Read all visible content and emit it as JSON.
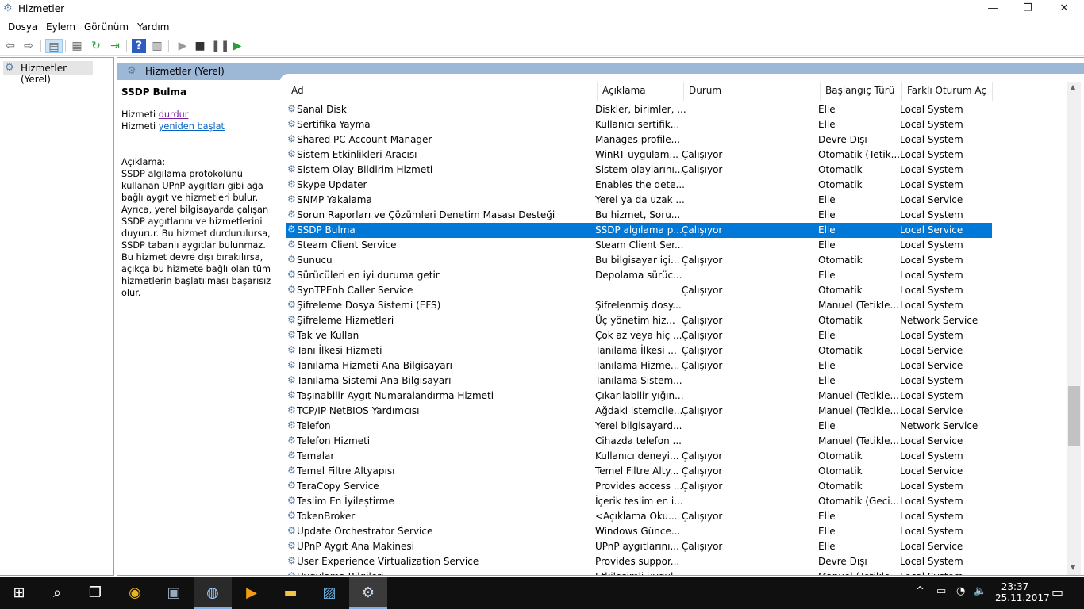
{
  "window": {
    "title": "Hizmetler",
    "minimize": "—",
    "maximize": "❐",
    "close": "✕"
  },
  "menu": [
    "Dosya",
    "Eylem",
    "Görünüm",
    "Yardım"
  ],
  "toolbar": [
    "back-icon",
    "forward-icon",
    "show-hide-tree-icon",
    "properties-icon",
    "refresh-icon",
    "export-icon",
    "help-icon",
    "console-icon",
    "start-icon",
    "stop-icon",
    "pause-icon",
    "resume-icon"
  ],
  "tree": {
    "item": "Hizmetler (Yerel)"
  },
  "center": {
    "header": "Hizmetler (Yerel)"
  },
  "detail": {
    "title": "SSDP Bulma",
    "prefix": "Hizmeti ",
    "stop_link": "durdur",
    "restart_link": "yeniden başlat",
    "desc_label": "Açıklama:",
    "desc": "SSDP algılama protokolünü kullanan UPnP aygıtları gibi ağa bağlı aygıt ve hizmetleri bulur. Ayrıca, yerel bilgisayarda çalışan SSDP aygıtlarını ve hizmetlerini duyurur. Bu hizmet durdurulursa, SSDP tabanlı aygıtlar bulunmaz. Bu hizmet devre dışı bırakılırsa, açıkça bu hizmete bağlı olan tüm hizmetlerin başlatılması başarısız olur."
  },
  "columns": [
    "Ad",
    "Açıklama",
    "Durum",
    "Başlangıç Türü",
    "Farklı Oturum Aç"
  ],
  "selected_row": 8,
  "rows": [
    [
      "Sanal Disk",
      "Diskler, birimler, ...",
      "",
      "Elle",
      "Local System"
    ],
    [
      "Sertifika Yayma",
      "Kullanıcı sertifik...",
      "",
      "Elle",
      "Local System"
    ],
    [
      "Shared PC Account Manager",
      "Manages profile...",
      "",
      "Devre Dışı",
      "Local System"
    ],
    [
      "Sistem Etkinlikleri Aracısı",
      "WinRT uygulam...",
      "Çalışıyor",
      "Otomatik (Tetik...",
      "Local System"
    ],
    [
      "Sistem Olay Bildirim Hizmeti",
      "Sistem olaylarını...",
      "Çalışıyor",
      "Otomatik",
      "Local System"
    ],
    [
      "Skype Updater",
      "Enables the dete...",
      "",
      "Otomatik",
      "Local System"
    ],
    [
      "SNMP Yakalama",
      "Yerel ya da uzak ...",
      "",
      "Elle",
      "Local Service"
    ],
    [
      "Sorun Raporları ve Çözümleri Denetim Masası Desteği",
      "Bu hizmet, Soru...",
      "",
      "Elle",
      "Local System"
    ],
    [
      "SSDP Bulma",
      "SSDP algılama p...",
      "Çalışıyor",
      "Elle",
      "Local Service"
    ],
    [
      "Steam Client Service",
      "Steam Client Ser...",
      "",
      "Elle",
      "Local System"
    ],
    [
      "Sunucu",
      "Bu bilgisayar içi...",
      "Çalışıyor",
      "Otomatik",
      "Local System"
    ],
    [
      "Sürücüleri en iyi duruma getir",
      "Depolama sürüc...",
      "",
      "Elle",
      "Local System"
    ],
    [
      "SynTPEnh Caller Service",
      "",
      "Çalışıyor",
      "Otomatik",
      "Local System"
    ],
    [
      "Şifreleme Dosya Sistemi (EFS)",
      "Şifrelenmiş dosy...",
      "",
      "Manuel (Tetikle...",
      "Local System"
    ],
    [
      "Şifreleme Hizmetleri",
      "Üç yönetim hiz...",
      "Çalışıyor",
      "Otomatik",
      "Network Service"
    ],
    [
      "Tak ve Kullan",
      "Çok az veya hiç ...",
      "Çalışıyor",
      "Elle",
      "Local System"
    ],
    [
      "Tanı İlkesi Hizmeti",
      "Tanılama İlkesi ...",
      "Çalışıyor",
      "Otomatik",
      "Local Service"
    ],
    [
      "Tanılama Hizmeti Ana Bilgisayarı",
      "Tanılama Hizme...",
      "Çalışıyor",
      "Elle",
      "Local Service"
    ],
    [
      "Tanılama Sistemi Ana Bilgisayarı",
      "Tanılama Sistem...",
      "",
      "Elle",
      "Local System"
    ],
    [
      "Taşınabilir Aygıt Numaralandırma Hizmeti",
      "Çıkarılabilir yığın...",
      "",
      "Manuel (Tetikle...",
      "Local System"
    ],
    [
      "TCP/IP NetBIOS Yardımcısı",
      "Ağdaki istemcile...",
      "Çalışıyor",
      "Manuel (Tetikle...",
      "Local Service"
    ],
    [
      "Telefon",
      "Yerel bilgisayard...",
      "",
      "Elle",
      "Network Service"
    ],
    [
      "Telefon Hizmeti",
      "Cihazda telefon ...",
      "",
      "Manuel (Tetikle...",
      "Local Service"
    ],
    [
      "Temalar",
      "Kullanıcı deneyi...",
      "Çalışıyor",
      "Otomatik",
      "Local System"
    ],
    [
      "Temel Filtre Altyapısı",
      "Temel Filtre Alty...",
      "Çalışıyor",
      "Otomatik",
      "Local Service"
    ],
    [
      "TeraCopy Service",
      "Provides access ...",
      "Çalışıyor",
      "Otomatik",
      "Local System"
    ],
    [
      "Teslim En İyileştirme",
      "İçerik teslim en i...",
      "",
      "Otomatik (Geci...",
      "Local System"
    ],
    [
      "TokenBroker",
      "<Açıklama Oku...",
      "Çalışıyor",
      "Elle",
      "Local System"
    ],
    [
      "Update Orchestrator Service",
      "Windows Günce...",
      "",
      "Elle",
      "Local System"
    ],
    [
      "UPnP Aygıt Ana Makinesi",
      "UPnP aygıtlarını...",
      "Çalışıyor",
      "Elle",
      "Local Service"
    ],
    [
      "User Experience Virtualization Service",
      "Provides suppor...",
      "",
      "Devre Dışı",
      "Local System"
    ],
    [
      "Uygulama Bilgileri",
      "Etkileşimli uygul...",
      "",
      "Manuel (Tetikle...",
      "Local System"
    ]
  ],
  "taskbar": {
    "apps": [
      "chrome-icon",
      "photos-icon",
      "steam-icon",
      "media-player-icon",
      "file-explorer-icon",
      "image-viewer-icon",
      "services-icon"
    ],
    "time": "23:37",
    "date": "25.11.2017"
  },
  "colors": {
    "selection": "#0078d7",
    "header_band": "#9db8d6",
    "taskbar": "#101010"
  }
}
